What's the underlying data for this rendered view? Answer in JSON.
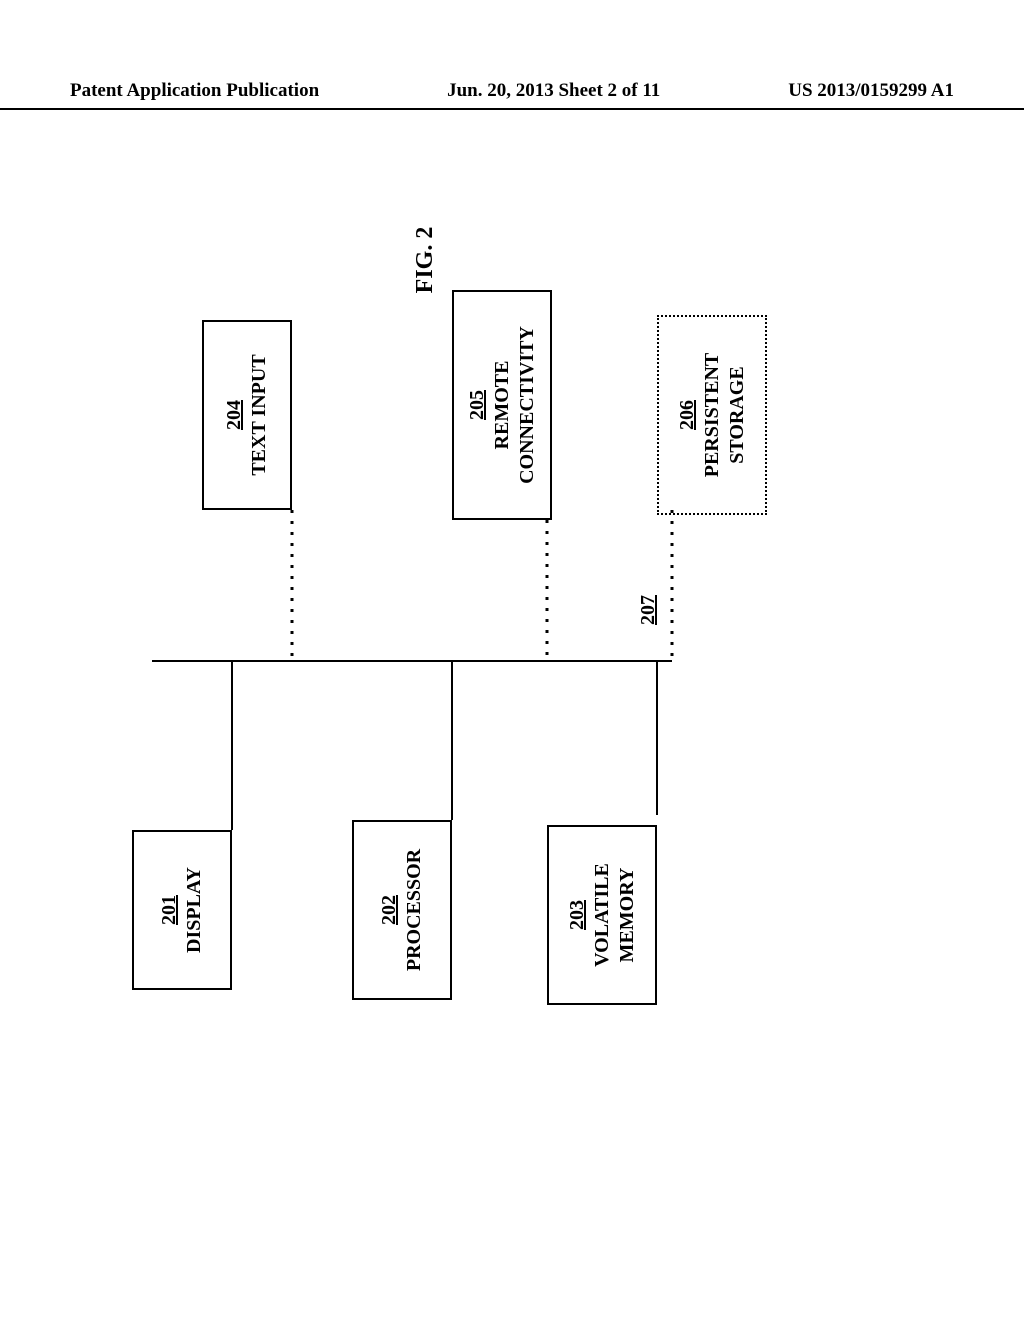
{
  "header": {
    "left": "Patent Application Publication",
    "center": "Jun. 20, 2013  Sheet 2 of 11",
    "right": "US 2013/0159299 A1"
  },
  "figure_label": "FIG. 2",
  "bus_ref": "207",
  "boxes": {
    "display": {
      "ref": "201",
      "label": "DISPLAY"
    },
    "processor": {
      "ref": "202",
      "label": "PROCESSOR"
    },
    "memory": {
      "ref": "203",
      "label": "VOLATILE\nMEMORY"
    },
    "textinput": {
      "ref": "204",
      "label": "TEXT INPUT"
    },
    "remote": {
      "ref": "205",
      "label": "REMOTE\nCONNECTIVITY"
    },
    "storage": {
      "ref": "206",
      "label": "PERSISTENT\nSTORAGE"
    }
  }
}
